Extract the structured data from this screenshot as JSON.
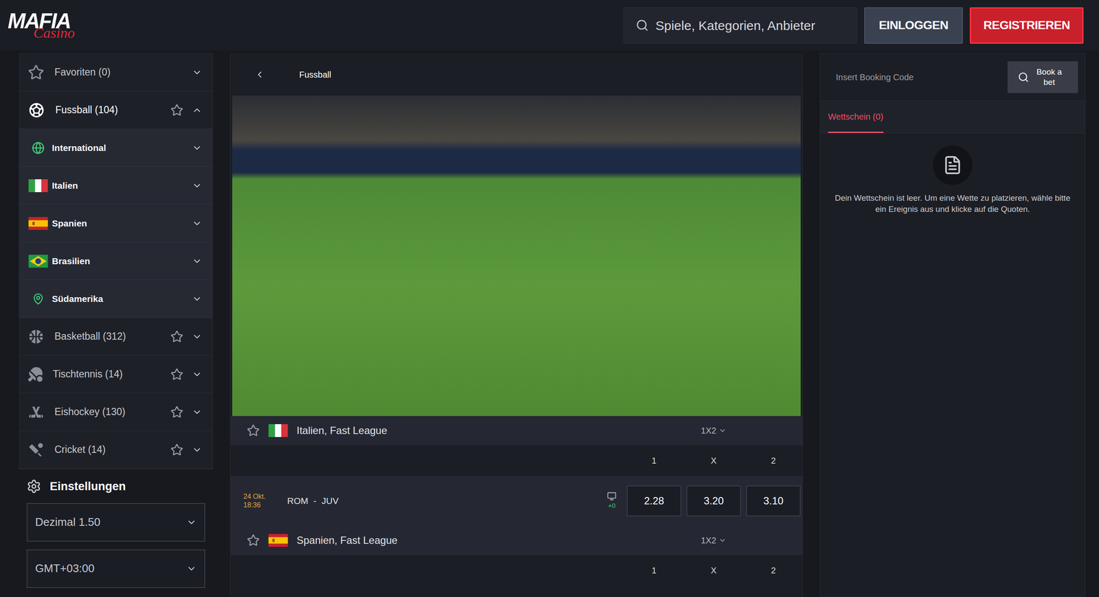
{
  "header": {
    "logo": {
      "top": "MAFIA",
      "bottom": "Casino"
    },
    "search": {
      "placeholder": "Spiele, Kategorien, Anbieter"
    },
    "buttons": [
      {
        "label": "EINLOGGEN",
        "kind": "secondary"
      },
      {
        "label": "REGISTRIEREN",
        "kind": "primary"
      }
    ]
  },
  "sidebar": {
    "sports": [
      {
        "label": "Favoriten (0)",
        "kind": "favorites",
        "expanded": false,
        "children": []
      },
      {
        "label": "Fussball (104)",
        "kind": "football",
        "expanded": true,
        "children": [
          {
            "label": "International",
            "kind": "world",
            "expanded": false
          },
          {
            "label": "Italien",
            "kind": "italy",
            "expanded": false
          },
          {
            "label": "Spanien",
            "kind": "spain",
            "expanded": false
          },
          {
            "label": "Brasilien",
            "kind": "brazil",
            "expanded": false
          },
          {
            "label": "Südamerika",
            "kind": "southamerica",
            "expanded": false
          }
        ]
      },
      {
        "label": "Basketball (312)",
        "kind": "basketball",
        "expanded": false,
        "children": []
      },
      {
        "label": "Tischtennis (14)",
        "kind": "tabletennis",
        "expanded": false,
        "children": []
      },
      {
        "label": "Eishockey (130)",
        "kind": "hockey",
        "expanded": false,
        "children": []
      },
      {
        "label": "Cricket (14)",
        "kind": "cricket",
        "expanded": false,
        "children": []
      }
    ],
    "settings": {
      "title": "Einstellungen",
      "selects": [
        "Dezimal 1.50",
        "GMT+03:00"
      ]
    }
  },
  "center": {
    "breadcrumb": "Fussball",
    "leagues": [
      {
        "name": "Italien, Fast League",
        "kind": "italy",
        "market": "1X2",
        "columns": [
          "1",
          "X",
          "2"
        ],
        "matches": [
          {
            "date": "24 Okt.",
            "time": "18:36",
            "home": "ROM",
            "separator": "-",
            "away": "JUV",
            "extra": "+0",
            "odds": [
              {
                "value": "2.28",
                "selected": false
              },
              {
                "value": "3.20",
                "selected": false
              },
              {
                "value": "3.10",
                "selected": false
              }
            ]
          }
        ]
      },
      {
        "name": "Spanien, Fast League",
        "kind": "spain",
        "market": "1X2",
        "columns": [
          "1",
          "X",
          "2"
        ],
        "matches": []
      }
    ]
  },
  "betslip": {
    "booking": {
      "placeholder": "Insert Booking Code",
      "button": "Book a bet"
    },
    "tabs": [
      {
        "label": "Wettschein (0)",
        "selected": true
      }
    ],
    "empty_message": "Dein Wettschein ist leer. Um eine Wette zu platzieren, wähle bitte ein Ereignis aus und klicke auf die Quoten."
  }
}
